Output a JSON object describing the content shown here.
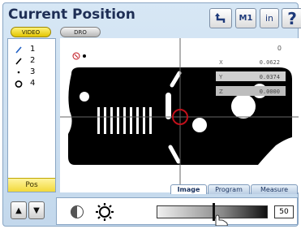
{
  "window": {
    "title": "Current Position"
  },
  "mode_buttons": {
    "video": "VIDEO",
    "dro": "DRO"
  },
  "toolbar": {
    "m1_label": "M1",
    "units_label": "in",
    "help_label": "?"
  },
  "features": [
    {
      "number": "1",
      "icon": "line-icon",
      "color": "#1f5fc4"
    },
    {
      "number": "2",
      "icon": "line-icon",
      "color": "#000000"
    },
    {
      "number": "3",
      "icon": "point-icon",
      "color": "#000000"
    },
    {
      "number": "4",
      "icon": "circle-icon",
      "color": "#000000"
    }
  ],
  "features_footer": "Pos",
  "readout": {
    "count": "0",
    "x_label": "X",
    "x_value": "0.0622",
    "y_label": "Y",
    "y_value": "0.0374",
    "z_label": "Z",
    "z_value": "0.0000"
  },
  "tabs": {
    "image": "Image",
    "program": "Program",
    "measure": "Measure"
  },
  "controls": {
    "light_level": "50",
    "light_fraction": 0.5
  },
  "colors": {
    "accent_yellow": "#f2d93a",
    "target_red": "#c0101a",
    "frame_blue": "#c3d8ec"
  }
}
